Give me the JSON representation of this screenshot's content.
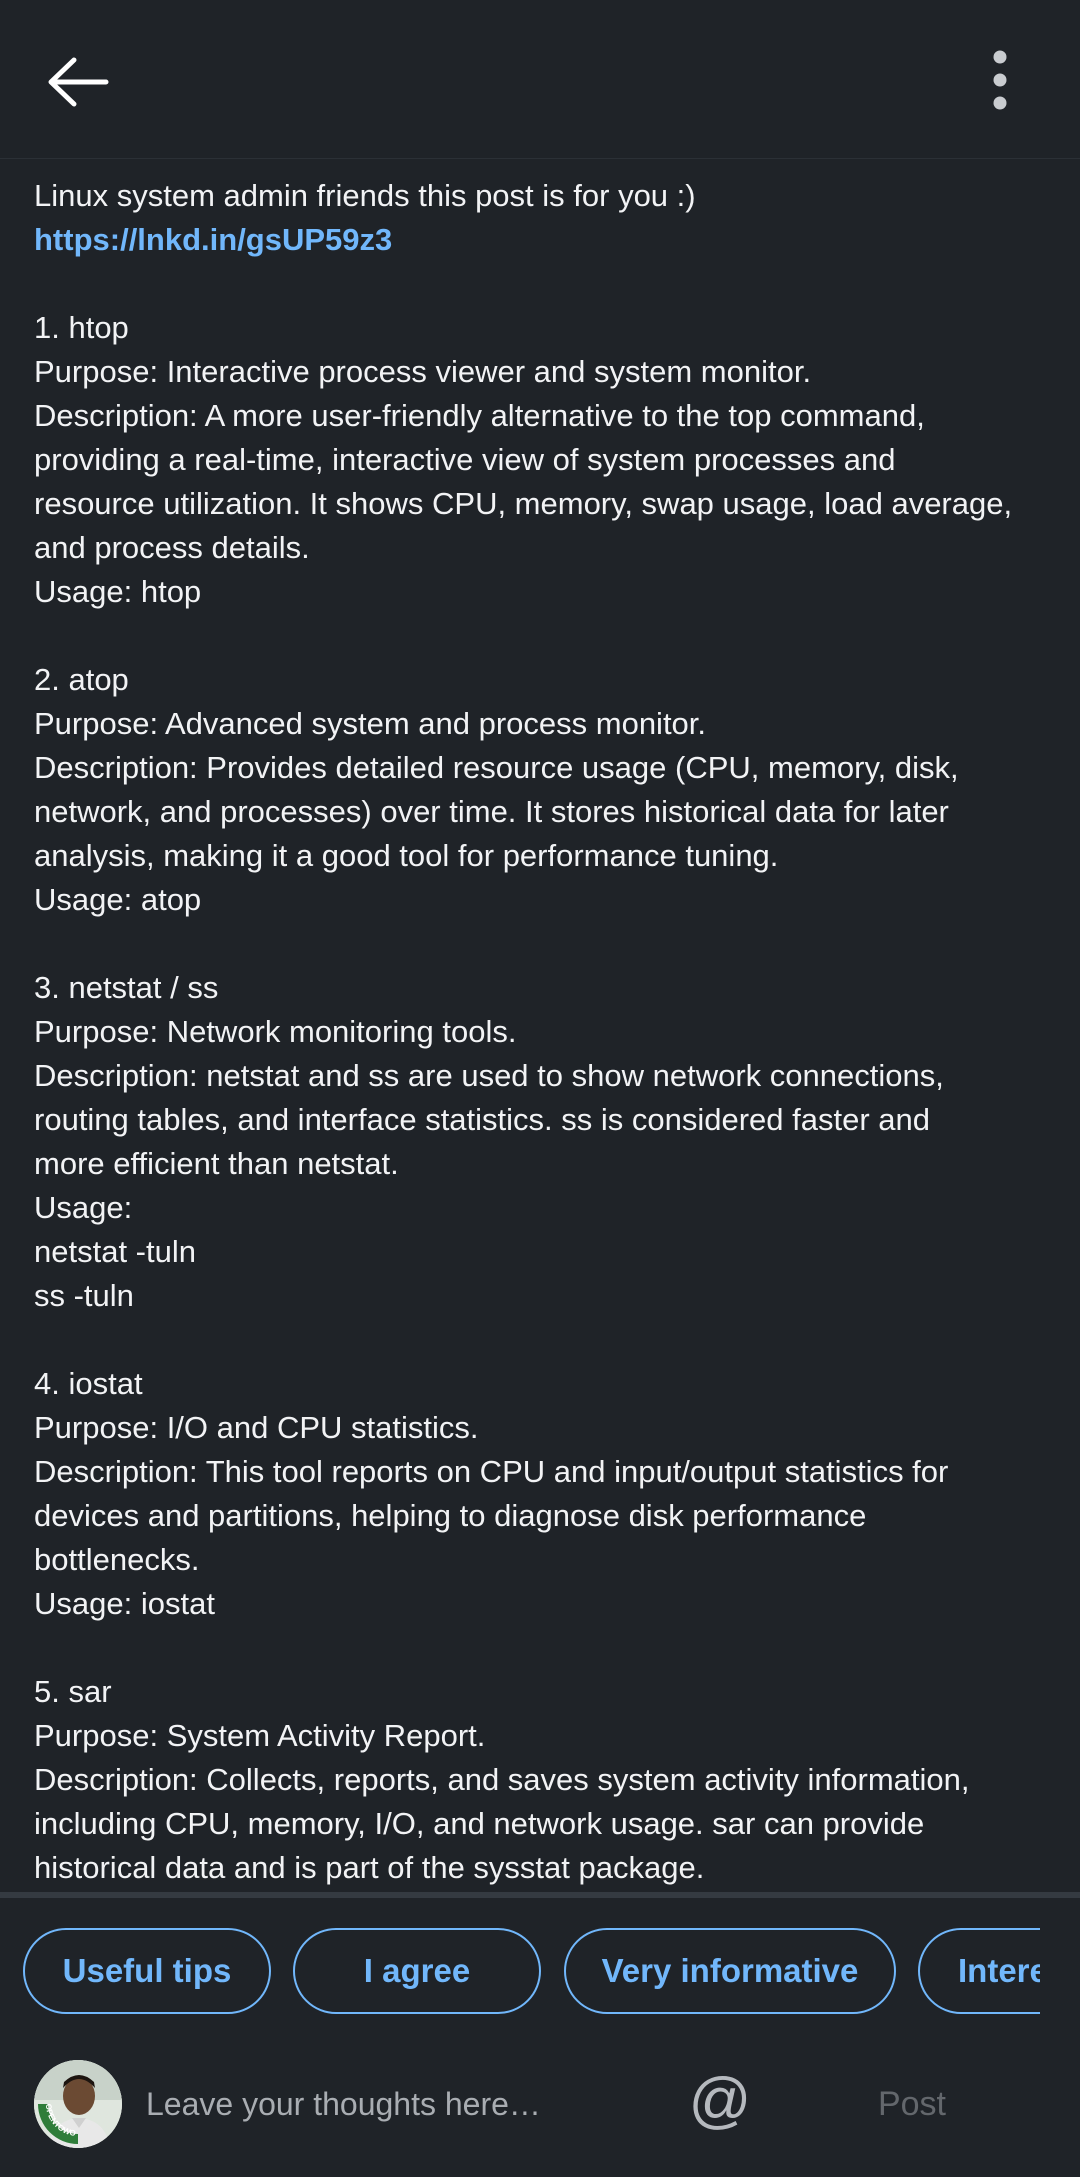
{
  "topbar": {
    "back_icon": "arrow-left-icon",
    "more_icon": "more-vertical-icon"
  },
  "post": {
    "lines": [
      "Linux system admin friends this post is for you :)",
      "https://lnkd.in/gsUP59z3",
      "",
      "1. htop",
      "Purpose: Interactive process viewer and system monitor.",
      "Description: A more user-friendly alternative to the top command,",
      "providing a real-time, interactive view of system processes and",
      "resource utilization. It shows CPU, memory, swap usage, load average,",
      "and process details.",
      "Usage: htop",
      "",
      "2. atop",
      "Purpose: Advanced system and process monitor.",
      "Description: Provides detailed resource usage (CPU, memory, disk,",
      "network, and processes) over time. It stores historical data for later",
      "analysis, making it a good tool for performance tuning.",
      "Usage: atop",
      "",
      "3. netstat / ss",
      "Purpose: Network monitoring tools.",
      "Description: netstat and ss are used to show network connections,",
      "routing tables, and interface statistics. ss is considered faster and",
      "more efficient than netstat.",
      "Usage:",
      "netstat -tuln",
      "ss -tuln",
      "",
      "4. iostat",
      "Purpose: I/O and CPU statistics.",
      "Description: This tool reports on CPU and input/output statistics for",
      "devices and partitions, helping to diagnose disk performance",
      "bottlenecks.",
      "Usage: iostat",
      "",
      "5. sar",
      "Purpose: System Activity Report.",
      "Description: Collects, reports, and saves system activity information,",
      "including CPU, memory, I/O, and network usage. sar can provide",
      "historical data and is part of the sysstat package."
    ]
  },
  "quick_replies": [
    "Useful tips",
    "I agree",
    "Very informative",
    "Intere"
  ],
  "composer": {
    "placeholder": "Leave your thoughts here…",
    "mention_symbol": "@",
    "post_label": "Post",
    "avatar_badge_text": "OPENTOWORK"
  },
  "colors": {
    "background": "#1f2328",
    "accent": "#71b7fb",
    "text": "#f2f3f5",
    "muted": "#a9adb2",
    "open_to_work_green": "#2f7d3a"
  }
}
